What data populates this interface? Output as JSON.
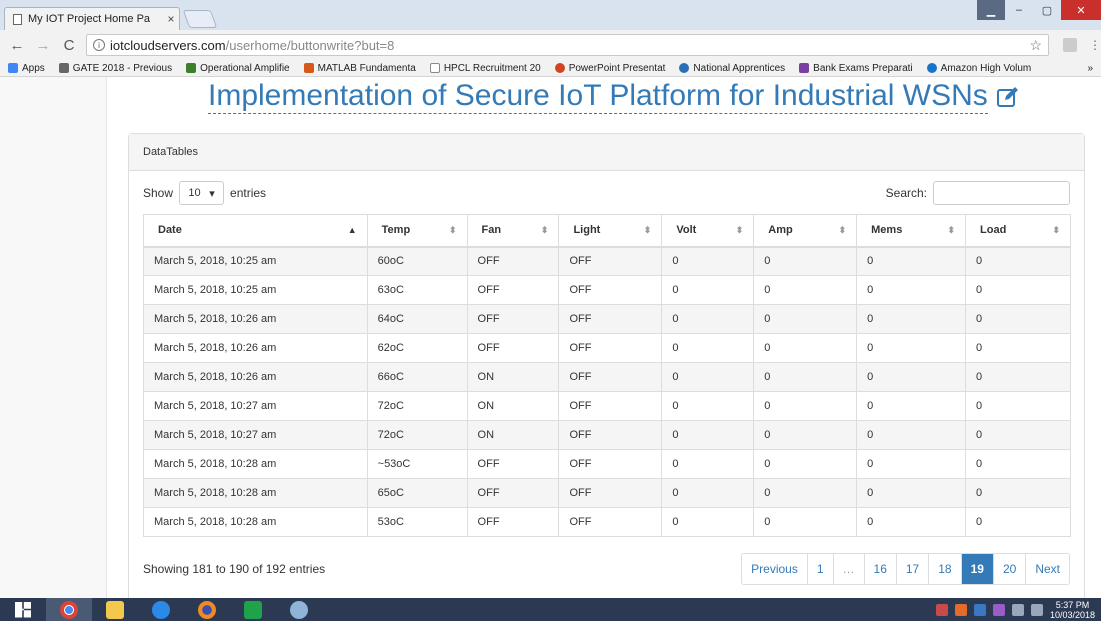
{
  "browser": {
    "tab_title": "My IOT Project Home Pa",
    "tab_close": "×",
    "url_host": "iotcloudservers.com",
    "url_path": "/userhome/buttonwrite?but=8",
    "bookmarks": [
      {
        "label": "Apps",
        "icon": "apps-grid-icon",
        "color": "#4285f4"
      },
      {
        "label": "GATE 2018 - Previous",
        "icon": "gear-icon",
        "color": "#666666"
      },
      {
        "label": "Operational Amplifie",
        "icon": "opamp-icon",
        "color": "#3d7f2f"
      },
      {
        "label": "MATLAB Fundamenta",
        "icon": "matlab-icon",
        "color": "#d8571b"
      },
      {
        "label": "HPCL Recruitment 20",
        "icon": "page-icon",
        "color": "#888888"
      },
      {
        "label": "PowerPoint Presentat",
        "icon": "powerpoint-icon",
        "color": "#d04423"
      },
      {
        "label": "National Apprentices",
        "icon": "apprentice-icon",
        "color": "#2a6fb5"
      },
      {
        "label": "Bank Exams Preparati",
        "icon": "bank-icon",
        "color": "#7b3fa3"
      },
      {
        "label": "Amazon High Volum",
        "icon": "cloud-icon",
        "color": "#1a73c9"
      }
    ],
    "bookmarks_more": "»"
  },
  "page": {
    "title": "Implementation of Secure IoT Platform for Industrial WSNs",
    "panel_heading": "DataTables",
    "length_label_before": "Show",
    "length_value": "10",
    "length_label_after": "entries",
    "search_label": "Search:",
    "columns": [
      "Date",
      "Temp",
      "Fan",
      "Light",
      "Volt",
      "Amp",
      "Mems",
      "Load"
    ],
    "rows": [
      [
        "March 5, 2018, 10:25 am",
        "60oC",
        "OFF",
        "OFF",
        "0",
        "0",
        "0",
        "0"
      ],
      [
        "March 5, 2018, 10:25 am",
        "63oC",
        "OFF",
        "OFF",
        "0",
        "0",
        "0",
        "0"
      ],
      [
        "March 5, 2018, 10:26 am",
        "64oC",
        "OFF",
        "OFF",
        "0",
        "0",
        "0",
        "0"
      ],
      [
        "March 5, 2018, 10:26 am",
        "62oC",
        "OFF",
        "OFF",
        "0",
        "0",
        "0",
        "0"
      ],
      [
        "March 5, 2018, 10:26 am",
        "66oC",
        "ON",
        "OFF",
        "0",
        "0",
        "0",
        "0"
      ],
      [
        "March 5, 2018, 10:27 am",
        "72oC",
        "ON",
        "OFF",
        "0",
        "0",
        "0",
        "0"
      ],
      [
        "March 5, 2018, 10:27 am",
        "72oC",
        "ON",
        "OFF",
        "0",
        "0",
        "0",
        "0"
      ],
      [
        "March 5, 2018, 10:28 am",
        "~53oC",
        "OFF",
        "OFF",
        "0",
        "0",
        "0",
        "0"
      ],
      [
        "March 5, 2018, 10:28 am",
        "65oC",
        "OFF",
        "OFF",
        "0",
        "0",
        "0",
        "0"
      ],
      [
        "March 5, 2018, 10:28 am",
        "53oC",
        "OFF",
        "OFF",
        "0",
        "0",
        "0",
        "0"
      ]
    ],
    "info": "Showing 181 to 190 of 192 entries",
    "pagination": {
      "previous": "Previous",
      "pages": [
        "1",
        "…",
        "16",
        "17",
        "18",
        "19",
        "20"
      ],
      "active": "19",
      "next": "Next"
    },
    "accent_color": "#337ab7"
  },
  "taskbar": {
    "apps": [
      "windows-start-icon",
      "chrome-icon",
      "file-explorer-icon",
      "internet-explorer-icon",
      "firefox-icon",
      "store-icon",
      "paint-icon"
    ],
    "clock_time": "5:37 PM",
    "clock_date": "10/03/2018"
  }
}
